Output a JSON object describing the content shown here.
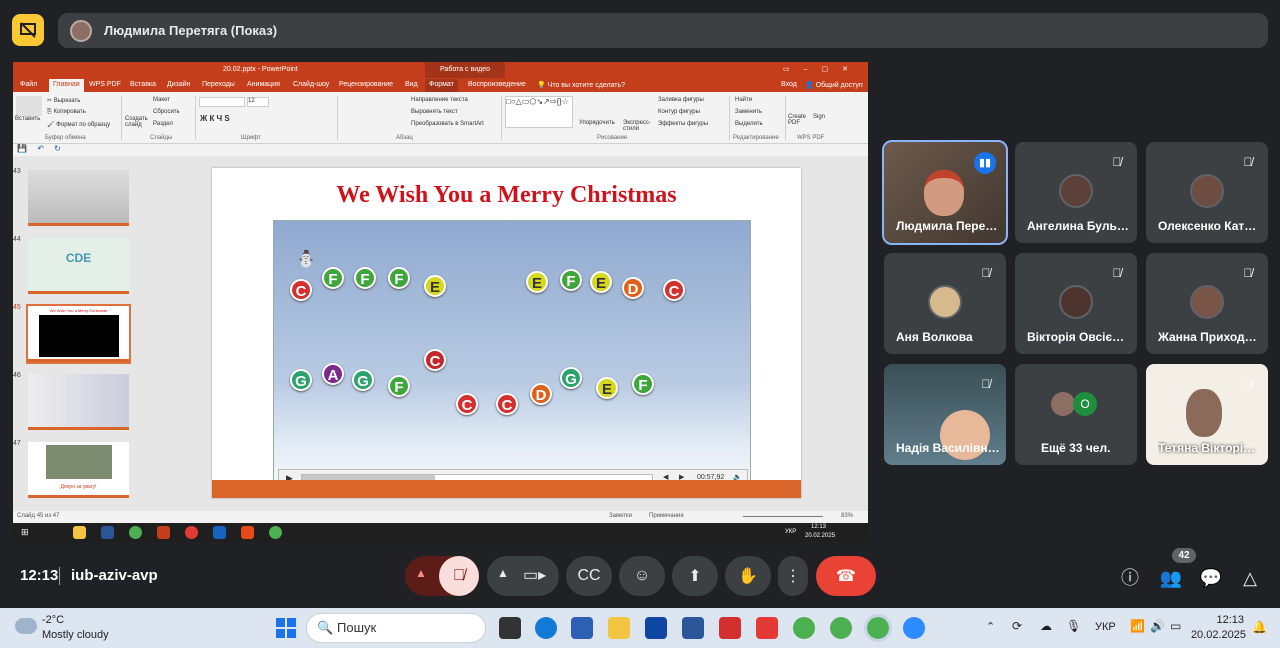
{
  "header": {
    "presenter_label": "Людмила Перетяга (Показ)"
  },
  "powerpoint": {
    "window_title": "20.02.pptx - PowerPoint",
    "video_tools_label": "Работа с видео",
    "tabs": [
      "Файл",
      "Главная",
      "WPS PDF",
      "Вставка",
      "Дизайн",
      "Переходы",
      "Анимация",
      "Слайд-шоу",
      "Рецензирование",
      "Вид",
      "Формат",
      "Воспроизведение"
    ],
    "tell_me": "Что вы хотите сделать?",
    "sign_in": "Вход",
    "share": "Общий доступ",
    "ribbon": {
      "paste": "Вставить",
      "cut": "Вырезать",
      "copy": "Копировать",
      "format_painter": "Формат по образцу",
      "clipboard": "Буфер обмена",
      "new_slide": "Создать слайд",
      "layout": "Макет",
      "reset": "Сбросить",
      "section": "Раздел",
      "slides": "Слайды",
      "font_size": "12",
      "font": "Шрифт",
      "text_direction": "Направление текста",
      "align_text": "Выровнять текст",
      "smartart": "Преобразовать в SmartArt",
      "paragraph": "Абзац",
      "arrange": "Упорядочить",
      "quick_styles": "Экспресс-стили",
      "shape_fill": "Заливка фигуры",
      "shape_outline": "Контур фигуры",
      "shape_effects": "Эффекты фигуры",
      "drawing": "Рисование",
      "find": "Найти",
      "replace": "Заменить",
      "select": "Выделить",
      "editing": "Редактирование",
      "create_pdf": "Create PDF",
      "sign": "Sign",
      "wps_pdf": "WPS PDF"
    },
    "thumbnails": [
      {
        "num": "43"
      },
      {
        "num": "44"
      },
      {
        "num": "45"
      },
      {
        "num": "46"
      },
      {
        "num": "47"
      }
    ],
    "thumb44_text": "CDE",
    "thumb45_text": "We Wish You a Merry Christmas",
    "thumb47_text": "Дякую за увагу!",
    "slide_title": "We Wish You a Merry Christmas",
    "notes_row1": [
      "C",
      "F",
      "F",
      "F",
      "E",
      "E",
      "F",
      "E",
      "D",
      "C"
    ],
    "notes_row2": [
      "G",
      "A",
      "G",
      "F",
      "C",
      "C",
      "C",
      "D",
      "G",
      "E",
      "F"
    ],
    "video_time": "00:57,92",
    "video_progress": 0.38,
    "status_slide": "Слайд 45 из 47",
    "status_notes": "Заметки",
    "status_comments": "Примечания",
    "zoom": "83%",
    "inner_lang": "УКР",
    "inner_time": "12:13",
    "inner_date": "20.02.2025"
  },
  "participants": [
    {
      "name": "Людмила Пере…",
      "speaking": true
    },
    {
      "name": "Ангелина Буль…",
      "muted": true
    },
    {
      "name": "Олексенко Кат…",
      "muted": true
    },
    {
      "name": "Аня Волкова",
      "muted": true
    },
    {
      "name": "Вікторія Овсіє…",
      "muted": true
    },
    {
      "name": "Жанна Приход…",
      "muted": true
    },
    {
      "name": "Надія Василівн…",
      "muted": true
    },
    {
      "name": "Ещё 33 чел.",
      "more_initial": "О"
    },
    {
      "name": "Тетяна Вікторі…",
      "muted": true
    }
  ],
  "controls": {
    "time": "12:13",
    "meeting_code": "iub-aziv-avp",
    "people_count": "42"
  },
  "taskbar": {
    "temperature": "-2°C",
    "weather": "Mostly cloudy",
    "search_placeholder": "Пошук",
    "lang": "УКР",
    "time": "12:13",
    "date": "20.02.2025"
  },
  "colors": {
    "accent": "#1a73e8",
    "end_call": "#ea4335",
    "present_yellow": "#fcc934",
    "powerpoint_red": "#c43e1c"
  }
}
